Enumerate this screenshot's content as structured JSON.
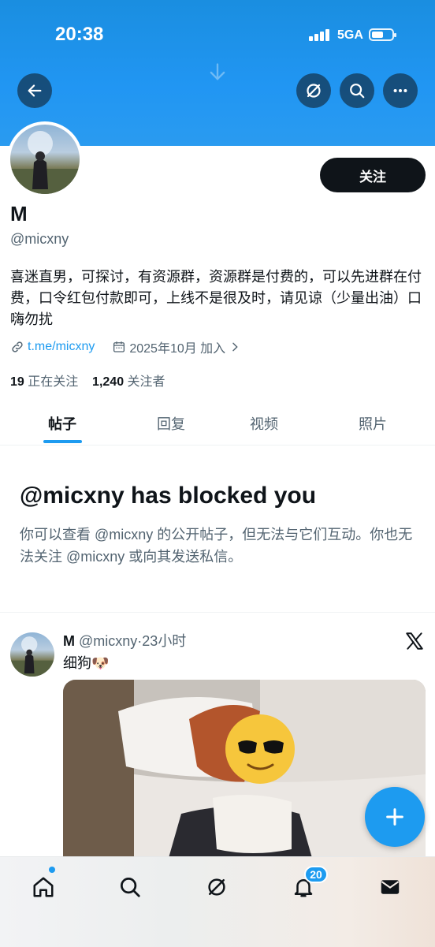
{
  "status_bar": {
    "time": "20:38",
    "network": "5GA"
  },
  "profile": {
    "name": "M",
    "handle": "@micxny",
    "follow_label": "关注",
    "bio": "喜迷直男，可探讨，有资源群，资源群是付费的，可以先进群在付费，口令红包付款即可，上线不是很及时，请见谅（少量出油）口嗨勿扰",
    "link": "t.me/micxny",
    "joined": "2025年10月 加入",
    "following_count": "19",
    "following_label": "正在关注",
    "followers_count": "1,240",
    "followers_label": "关注者"
  },
  "tabs": [
    {
      "label": "帖子"
    },
    {
      "label": "回复"
    },
    {
      "label": "视频"
    },
    {
      "label": "照片"
    }
  ],
  "blocked": {
    "title": "@micxny has blocked you",
    "description": "你可以查看 @micxny 的公开帖子，但无法与它们互动。你也无法关注 @micxny 或向其发送私信。"
  },
  "post": {
    "name": "M",
    "handle": "@micxny",
    "time": "·23小时",
    "text": "细狗🐶"
  },
  "bottom_nav": {
    "notification_count": "20"
  },
  "colors": {
    "accent": "#1d9bf0",
    "banner": "#2196f3",
    "text": "#0f1419",
    "muted": "#536471"
  }
}
